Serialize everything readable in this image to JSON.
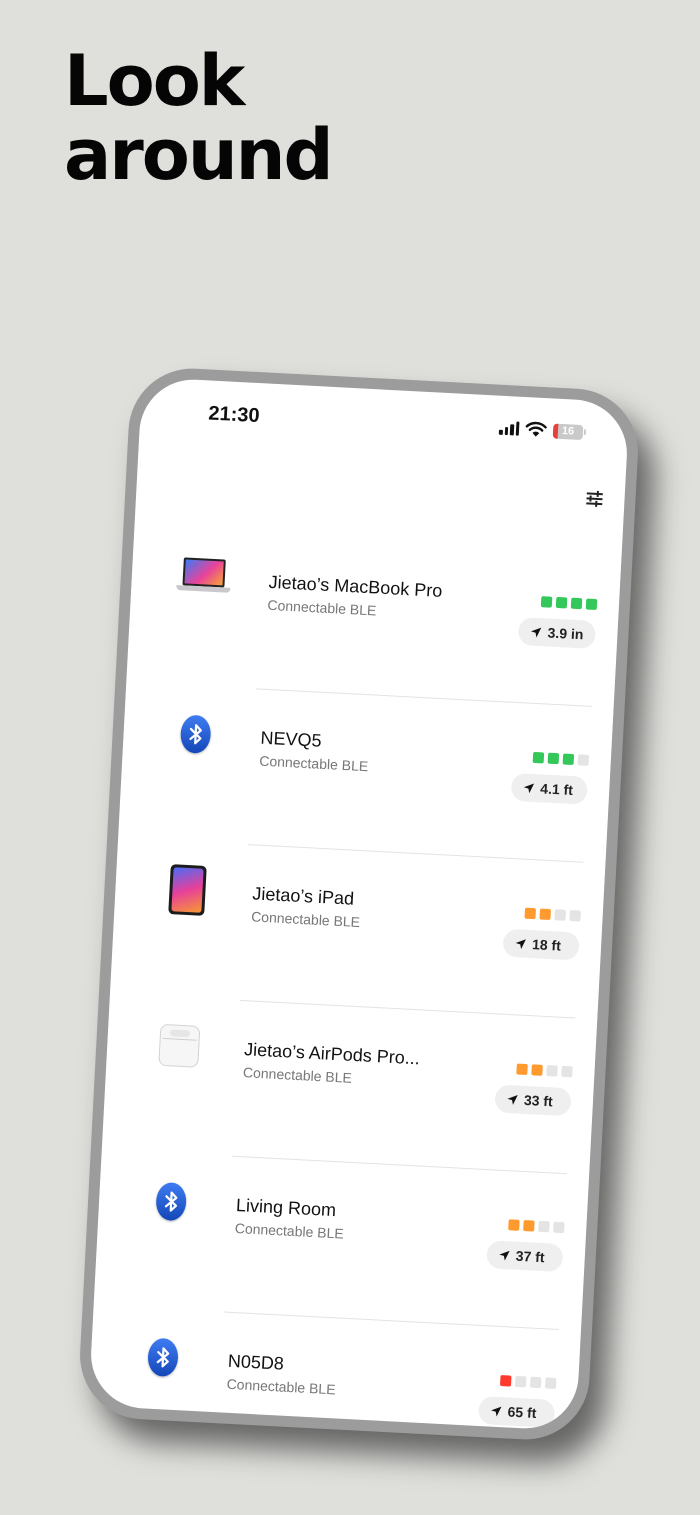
{
  "headline": {
    "line1": "Look",
    "line2": "around"
  },
  "status_bar": {
    "time": "21:30",
    "battery_level": "16"
  },
  "toolbar": {
    "filter_icon": "sliders-icon"
  },
  "colors": {
    "strong": "#34c759",
    "medium": "#ff9a2e",
    "weak": "#ff3b30",
    "empty": "#e4e4e4"
  },
  "devices": [
    {
      "name": "Jietao’s MacBook Pro",
      "subtitle": "Connectable BLE",
      "distance": "3.9 in",
      "signal": 4,
      "signal_color": "strong",
      "icon": "laptop-icon"
    },
    {
      "name": "NEVQ5",
      "subtitle": "Connectable BLE",
      "distance": "4.1 ft",
      "signal": 3,
      "signal_color": "strong",
      "icon": "bluetooth-icon"
    },
    {
      "name": "Jietao’s iPad",
      "subtitle": "Connectable BLE",
      "distance": "18 ft",
      "signal": 2,
      "signal_color": "medium",
      "icon": "ipad-icon"
    },
    {
      "name": "Jietao’s AirPods Pro...",
      "subtitle": "Connectable BLE",
      "distance": "33 ft",
      "signal": 2,
      "signal_color": "medium",
      "icon": "airpods-icon"
    },
    {
      "name": "Living Room",
      "subtitle": "Connectable BLE",
      "distance": "37 ft",
      "signal": 2,
      "signal_color": "medium",
      "icon": "bluetooth-icon"
    },
    {
      "name": "N05D8",
      "subtitle": "Connectable BLE",
      "distance": "65 ft",
      "signal": 1,
      "signal_color": "weak",
      "icon": "bluetooth-icon"
    }
  ]
}
